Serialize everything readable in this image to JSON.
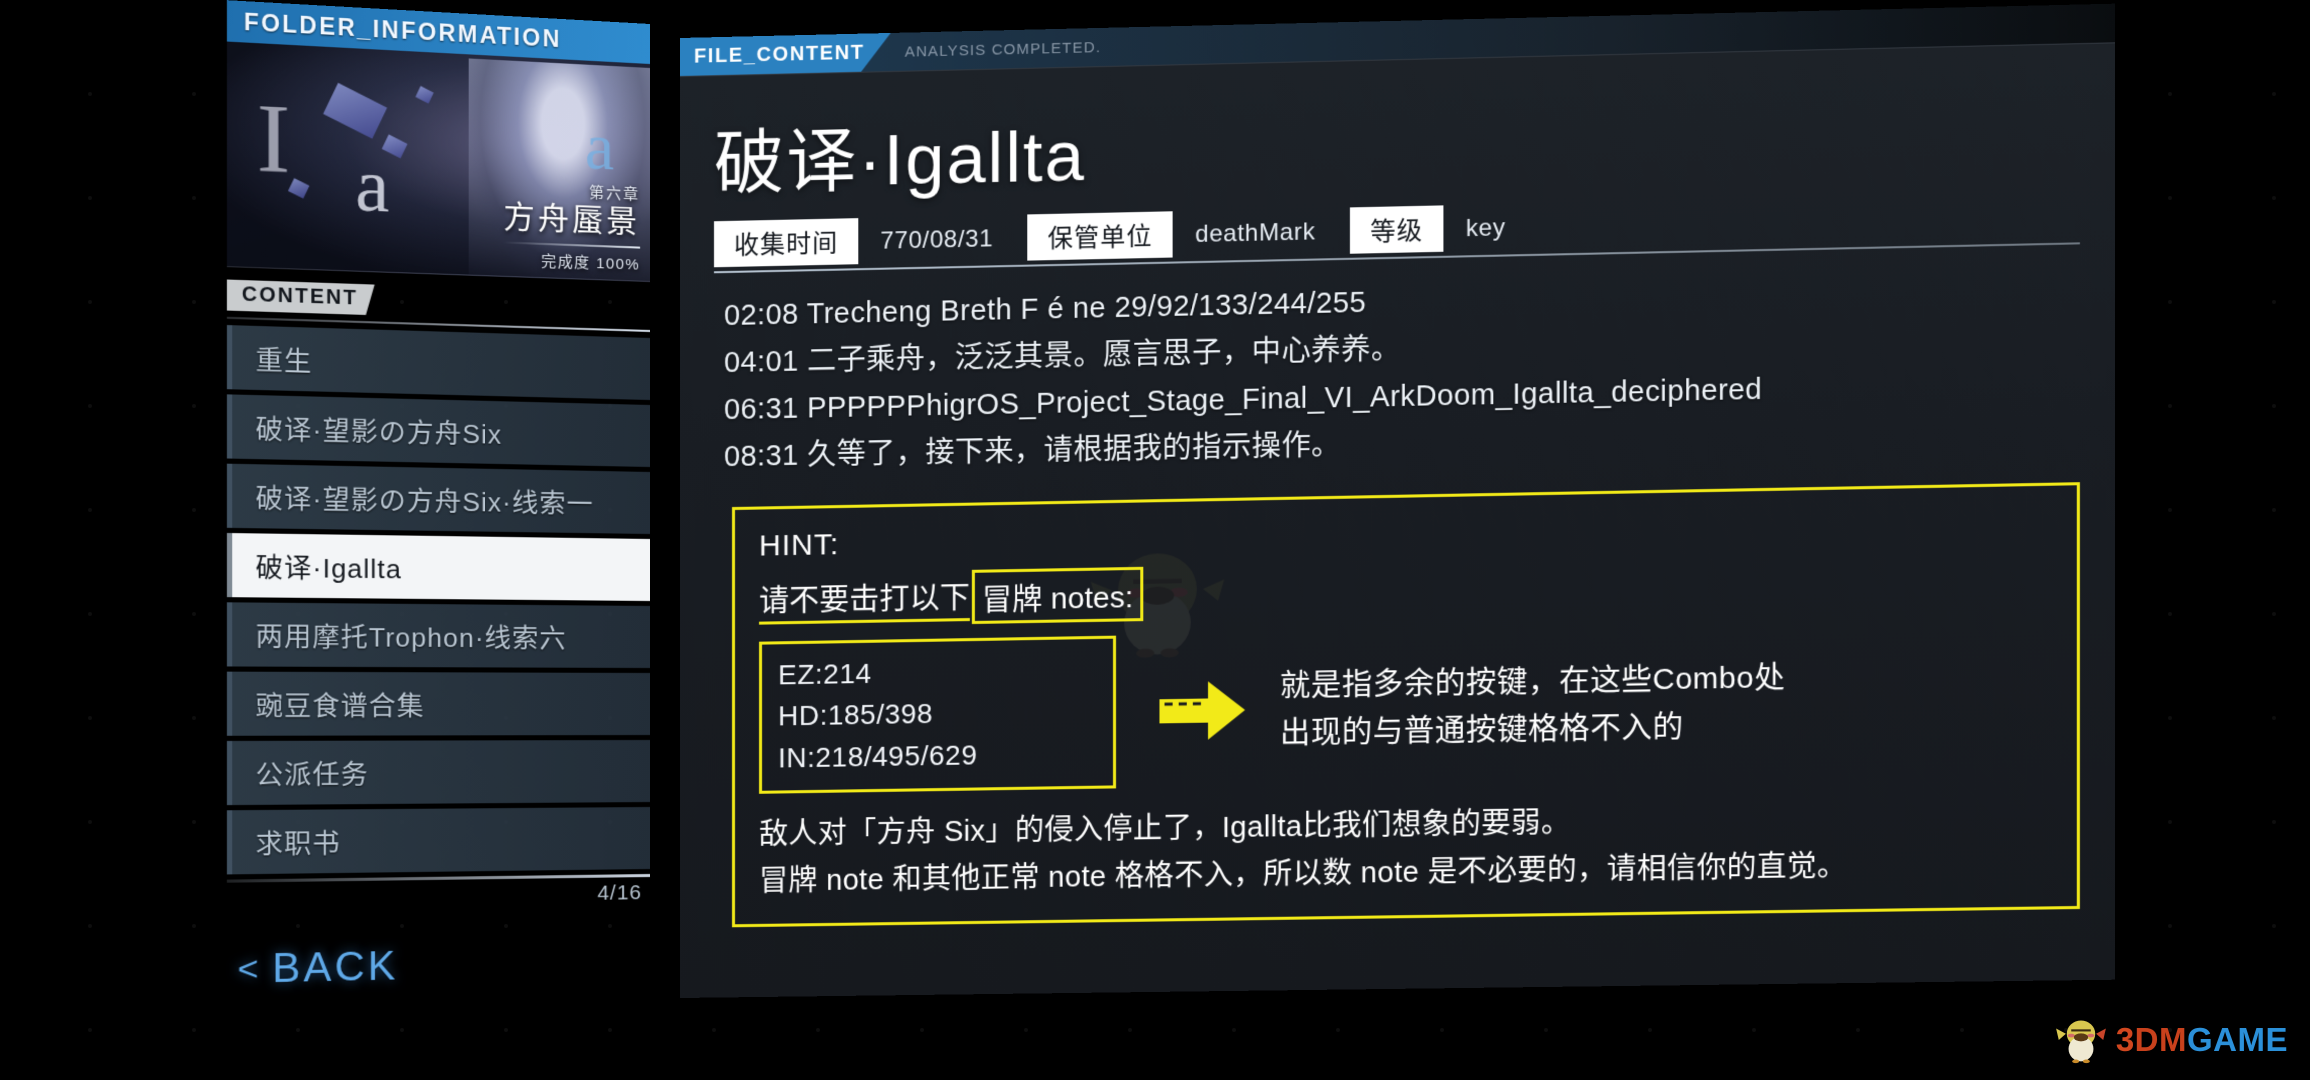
{
  "folder": {
    "tab_label": "FOLDER_INFORMATION",
    "art": {
      "glyph_i": "I",
      "glyph_a": "a",
      "glyph_alpha": "a"
    },
    "chapter_no": "第六章",
    "chapter_name": "方舟蜃景",
    "completion": "完成度 100%",
    "content_label": "CONTENT",
    "items": [
      {
        "label": "重生",
        "active": false
      },
      {
        "label": "破译·望影の方舟Six",
        "active": false
      },
      {
        "label": "破译·望影の方舟Six·线索一",
        "active": false
      },
      {
        "label": "破译·Igallta",
        "active": true
      },
      {
        "label": "两用摩托Trophon·线索六",
        "active": false
      },
      {
        "label": "豌豆食谱合集",
        "active": false
      },
      {
        "label": "公派任务",
        "active": false
      },
      {
        "label": "求职书",
        "active": false
      }
    ],
    "count": "4/16",
    "back_chevron": "<",
    "back_label": "BACK"
  },
  "file": {
    "tag": "FILE_CONTENT",
    "status": "ANALYSIS COMPLETED.",
    "title": "破译·Igallta",
    "meta": [
      {
        "key": "收集时间",
        "value": "770/08/31"
      },
      {
        "key": "保管单位",
        "value": "deathMark"
      },
      {
        "key": "等级",
        "value": "key"
      }
    ],
    "lines": [
      "02:08 Trecheng Breth F é ne 29/92/133/244/255",
      "04:01 二子乘舟，泛泛其景。愿言思子，中心养养。",
      "06:31 PPPPPPhigrOS_Project_Stage_Final_VI_ArkDoom_Igallta_deciphered",
      "08:31 久等了，接下来，请根据我的指示操作。"
    ],
    "hint": {
      "title": "HINT:",
      "line1_prefix": "请不要击打以下",
      "line1_boxed": "冒牌 notes:",
      "notes": [
        "EZ:214",
        "HD:185/398",
        "IN:218/495/629"
      ],
      "arrow_icon": "arrow-right-icon",
      "combo_lines": [
        "就是指多余的按键，在这些Combo处",
        "出现的与普通按键格格不入的"
      ],
      "tail_lines": [
        "敌人对「方舟 Six」的侵入停止了，Igallta比我们想象的要弱。",
        "冒牌 note 和其他正常 note 格格不入，所以数 note 是不必要的，请相信你的直觉。"
      ]
    }
  },
  "watermark": {
    "part1": "3",
    "part2": "DM",
    "part3": "GAME"
  },
  "colors": {
    "accent_blue": "#2b81c0",
    "hint_yellow": "#f2ea18",
    "panel_bg": "#1d2228",
    "list_bg": "#2e3c48",
    "active_bg": "#f3f5f7"
  }
}
